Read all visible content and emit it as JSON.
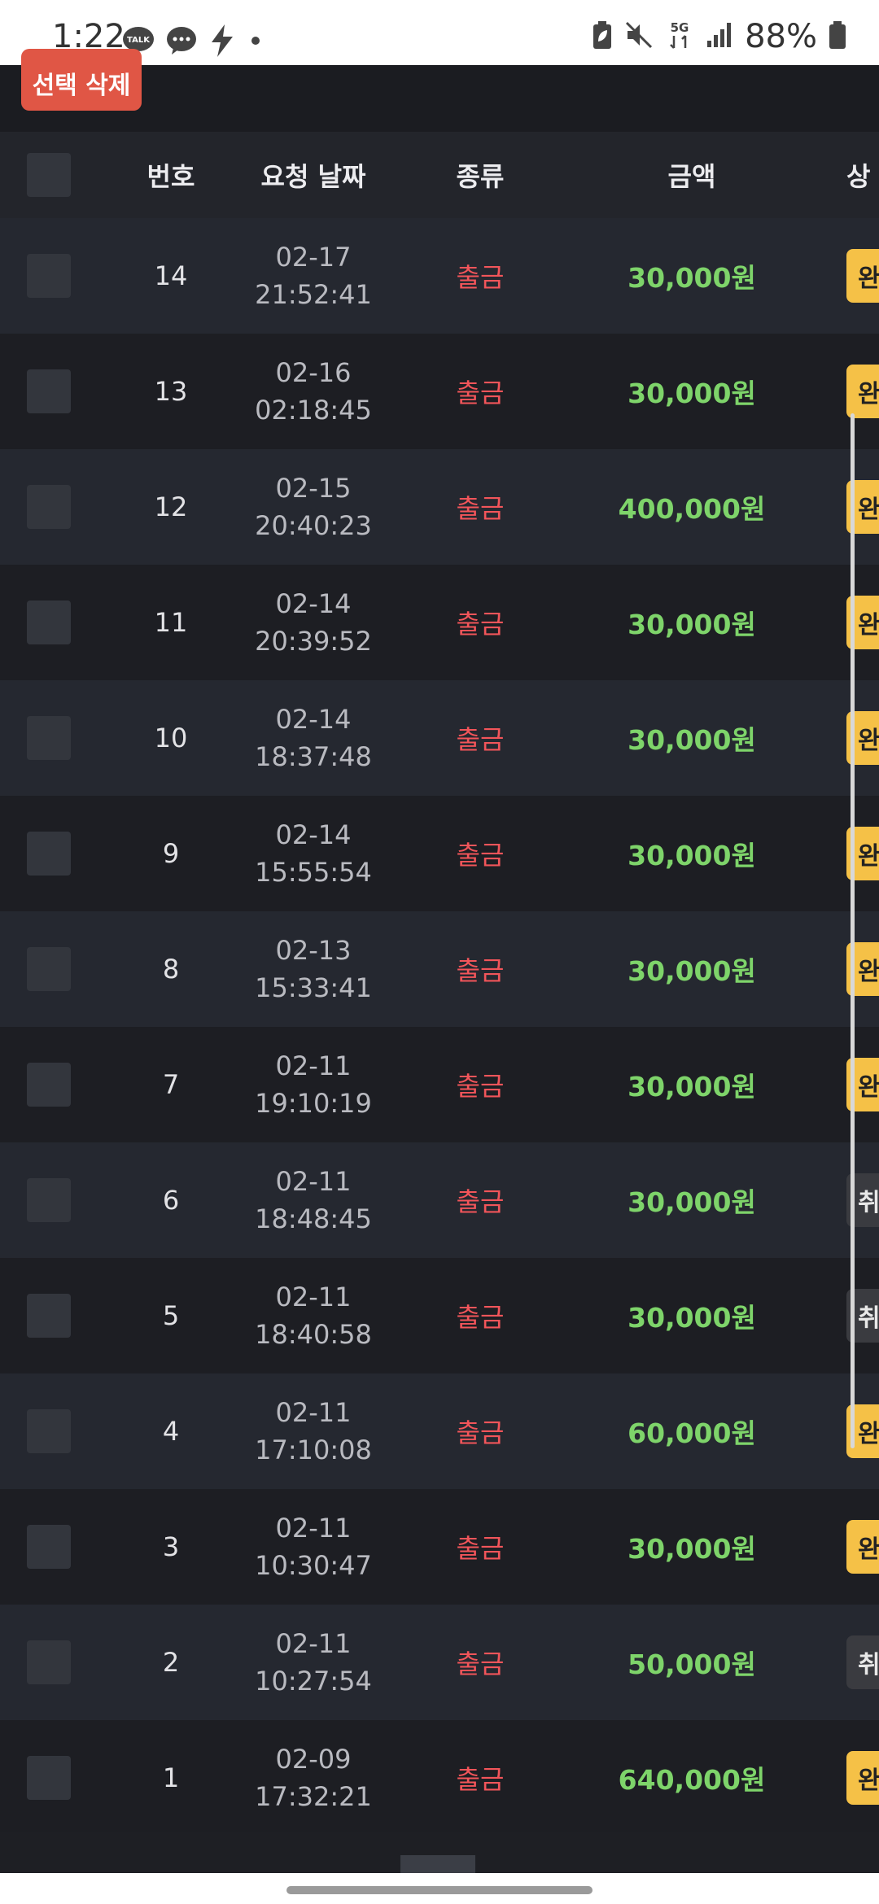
{
  "status_bar": {
    "time": "1:22",
    "battery_percent": "88%",
    "left_icons": [
      "kakaotalk-icon",
      "chat-bubble-icon",
      "flash-icon",
      "dot-icon"
    ],
    "right_icons": [
      "battery-saver-icon",
      "mute-icon",
      "5g-icon",
      "signal-icon",
      "battery-icon"
    ],
    "badge_talk": "TALK",
    "network": "5G"
  },
  "toolbar": {
    "delete_selected_label": "선택 삭제"
  },
  "table": {
    "headers": {
      "number": "번호",
      "request_date": "요청 날짜",
      "type": "종류",
      "amount": "금액",
      "status": "상"
    },
    "rows": [
      {
        "number": "14",
        "date": "02-17",
        "time": "21:52:41",
        "type": "출금",
        "amount": "30,000원",
        "status": "완",
        "status_kind": "done"
      },
      {
        "number": "13",
        "date": "02-16",
        "time": "02:18:45",
        "type": "출금",
        "amount": "30,000원",
        "status": "완",
        "status_kind": "done"
      },
      {
        "number": "12",
        "date": "02-15",
        "time": "20:40:23",
        "type": "출금",
        "amount": "400,000원",
        "status": "완",
        "status_kind": "done"
      },
      {
        "number": "11",
        "date": "02-14",
        "time": "20:39:52",
        "type": "출금",
        "amount": "30,000원",
        "status": "완",
        "status_kind": "done"
      },
      {
        "number": "10",
        "date": "02-14",
        "time": "18:37:48",
        "type": "출금",
        "amount": "30,000원",
        "status": "완",
        "status_kind": "done"
      },
      {
        "number": "9",
        "date": "02-14",
        "time": "15:55:54",
        "type": "출금",
        "amount": "30,000원",
        "status": "완",
        "status_kind": "done"
      },
      {
        "number": "8",
        "date": "02-13",
        "time": "15:33:41",
        "type": "출금",
        "amount": "30,000원",
        "status": "완",
        "status_kind": "done"
      },
      {
        "number": "7",
        "date": "02-11",
        "time": "19:10:19",
        "type": "출금",
        "amount": "30,000원",
        "status": "완",
        "status_kind": "done"
      },
      {
        "number": "6",
        "date": "02-11",
        "time": "18:48:45",
        "type": "출금",
        "amount": "30,000원",
        "status": "취",
        "status_kind": "cancel"
      },
      {
        "number": "5",
        "date": "02-11",
        "time": "18:40:58",
        "type": "출금",
        "amount": "30,000원",
        "status": "취",
        "status_kind": "cancel"
      },
      {
        "number": "4",
        "date": "02-11",
        "time": "17:10:08",
        "type": "출금",
        "amount": "60,000원",
        "status": "완",
        "status_kind": "done"
      },
      {
        "number": "3",
        "date": "02-11",
        "time": "10:30:47",
        "type": "출금",
        "amount": "30,000원",
        "status": "완",
        "status_kind": "done"
      },
      {
        "number": "2",
        "date": "02-11",
        "time": "10:27:54",
        "type": "출금",
        "amount": "50,000원",
        "status": "취",
        "status_kind": "cancel"
      },
      {
        "number": "1",
        "date": "02-09",
        "time": "17:32:21",
        "type": "출금",
        "amount": "640,000원",
        "status": "완",
        "status_kind": "done"
      }
    ]
  },
  "colors": {
    "background": "#1e1f24",
    "row_alt": "#252830",
    "delete_button": "#e05645",
    "withdraw_red": "#f2555a",
    "amount_green": "#7ed46a",
    "status_done": "#f5c147",
    "status_cancel": "#3a3b40"
  }
}
